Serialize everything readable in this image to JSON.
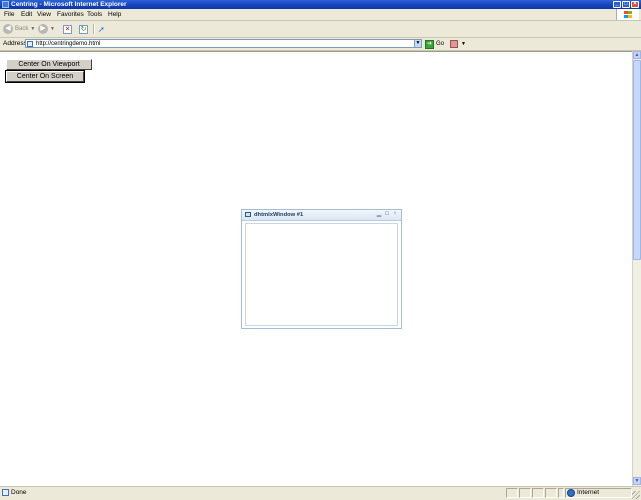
{
  "window": {
    "title": "Centring - Microsoft Internet Explorer",
    "controls": {
      "minimize": "_",
      "maximize": "□",
      "close": "×"
    }
  },
  "menu": {
    "items": [
      "File",
      "Edit",
      "View",
      "Favorites",
      "Tools",
      "Help"
    ]
  },
  "toolbar": {
    "back_label": "Back",
    "back_icon": "back-arrow-icon",
    "forward_icon": "forward-arrow-icon",
    "stop_icon": "stop-icon",
    "refresh_icon": "refresh-icon",
    "select_icon": "cursor-select-icon"
  },
  "address": {
    "label": "Address",
    "url": "http://centringdemo.html",
    "go_label": "Go"
  },
  "page": {
    "buttons": {
      "center_viewport": "Center On Viewport",
      "center_screen": "Center On Screen"
    },
    "dhx_window": {
      "title": "dhtmlxWindow #1",
      "minimize": "▁",
      "maximize": "□",
      "close": "×"
    }
  },
  "status": {
    "text": "Done",
    "zone": "Internet"
  },
  "colors": {
    "titlebar": "#0b36a8",
    "chrome": "#ece9d8",
    "dhx_border": "#a4bed4"
  }
}
